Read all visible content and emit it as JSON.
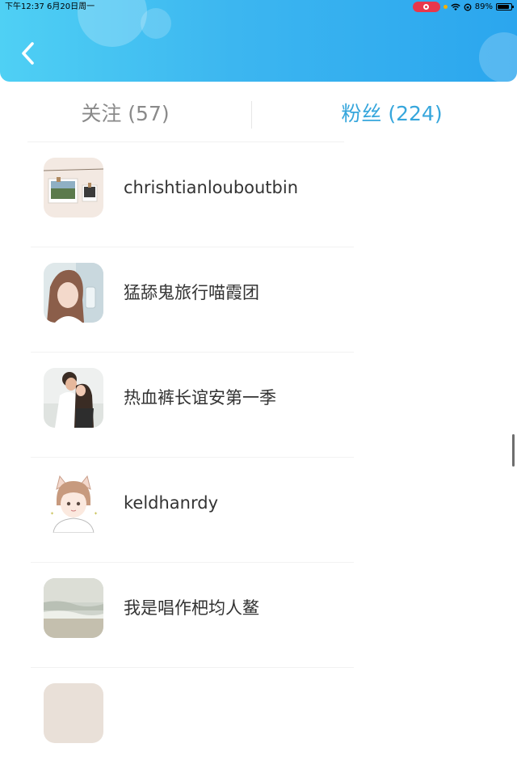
{
  "status_bar": {
    "time_date": "下午12:37   6月20日周一",
    "battery": "89%",
    "battery_level": 0.89
  },
  "header": {
    "back_icon": "chevron-left-icon"
  },
  "tabs": [
    {
      "label": "关注 (57)",
      "active": false
    },
    {
      "label": "粉丝 (224)",
      "active": true
    }
  ],
  "fans": [
    {
      "name": "chrishtianlouboutbin"
    },
    {
      "name": "猛舔鬼旅行喵霞团"
    },
    {
      "name": "热血裤长谊安第一季"
    },
    {
      "name": "keldhanrdy"
    },
    {
      "name": "我是唱作杷均人鳌"
    }
  ],
  "colors": {
    "header_gradient_start": "#4fd0f4",
    "header_gradient_end": "#2ba6ee",
    "active_tab": "#36a6dc",
    "inactive_tab": "#8a8a8a",
    "record_pill": "#e8374b"
  }
}
